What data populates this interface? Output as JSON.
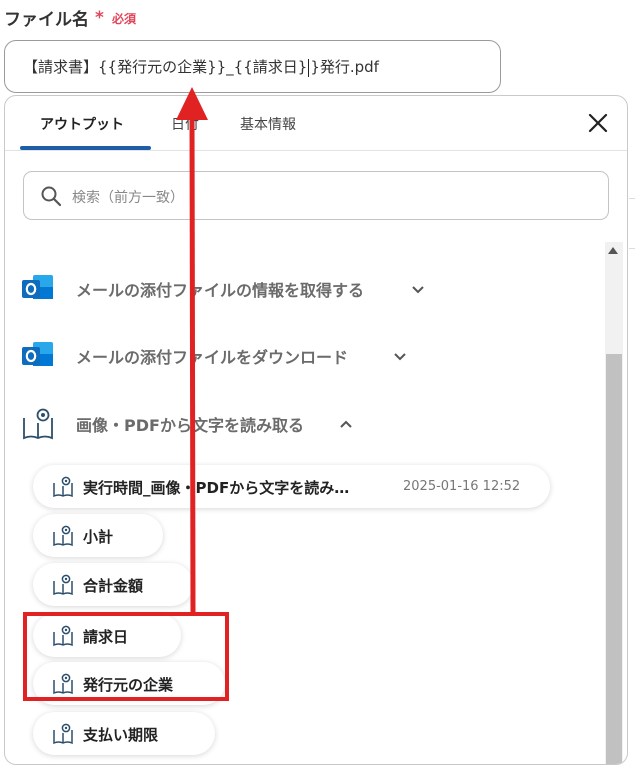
{
  "field": {
    "label": "ファイル名",
    "required_mark": "*",
    "required_text": "必須",
    "value_before_caret": "【請求書】{{発行元の企業}}_{{請求日}",
    "value_after_caret": "}発行.pdf"
  },
  "tabs": [
    {
      "label": "アウトプット",
      "active": true
    },
    {
      "label": "日付",
      "active": false
    },
    {
      "label": "基本情報",
      "active": false
    }
  ],
  "search": {
    "placeholder": "検索（前方一致）"
  },
  "sections": [
    {
      "title": "メールの添付ファイルの情報を取得する",
      "icon": "outlook-icon",
      "expanded": false
    },
    {
      "title": "メールの添付ファイルをダウンロード",
      "icon": "outlook-icon",
      "expanded": false
    },
    {
      "title": "画像・PDFから文字を読み取る",
      "icon": "ocr-book-icon",
      "expanded": true
    }
  ],
  "items": [
    {
      "label": "実行時間_画像・PDFから文字を読み…",
      "timestamp": "2025-01-16 12:52"
    },
    {
      "label": "小計"
    },
    {
      "label": "合計金額"
    },
    {
      "label": "請求日"
    },
    {
      "label": "発行元の企業"
    },
    {
      "label": "支払い期限"
    }
  ],
  "colors": {
    "accent_tab": "#1e5ea6",
    "required": "#e0475b",
    "annotation": "#e02222",
    "outlook_blue": "#0f6cbd"
  }
}
